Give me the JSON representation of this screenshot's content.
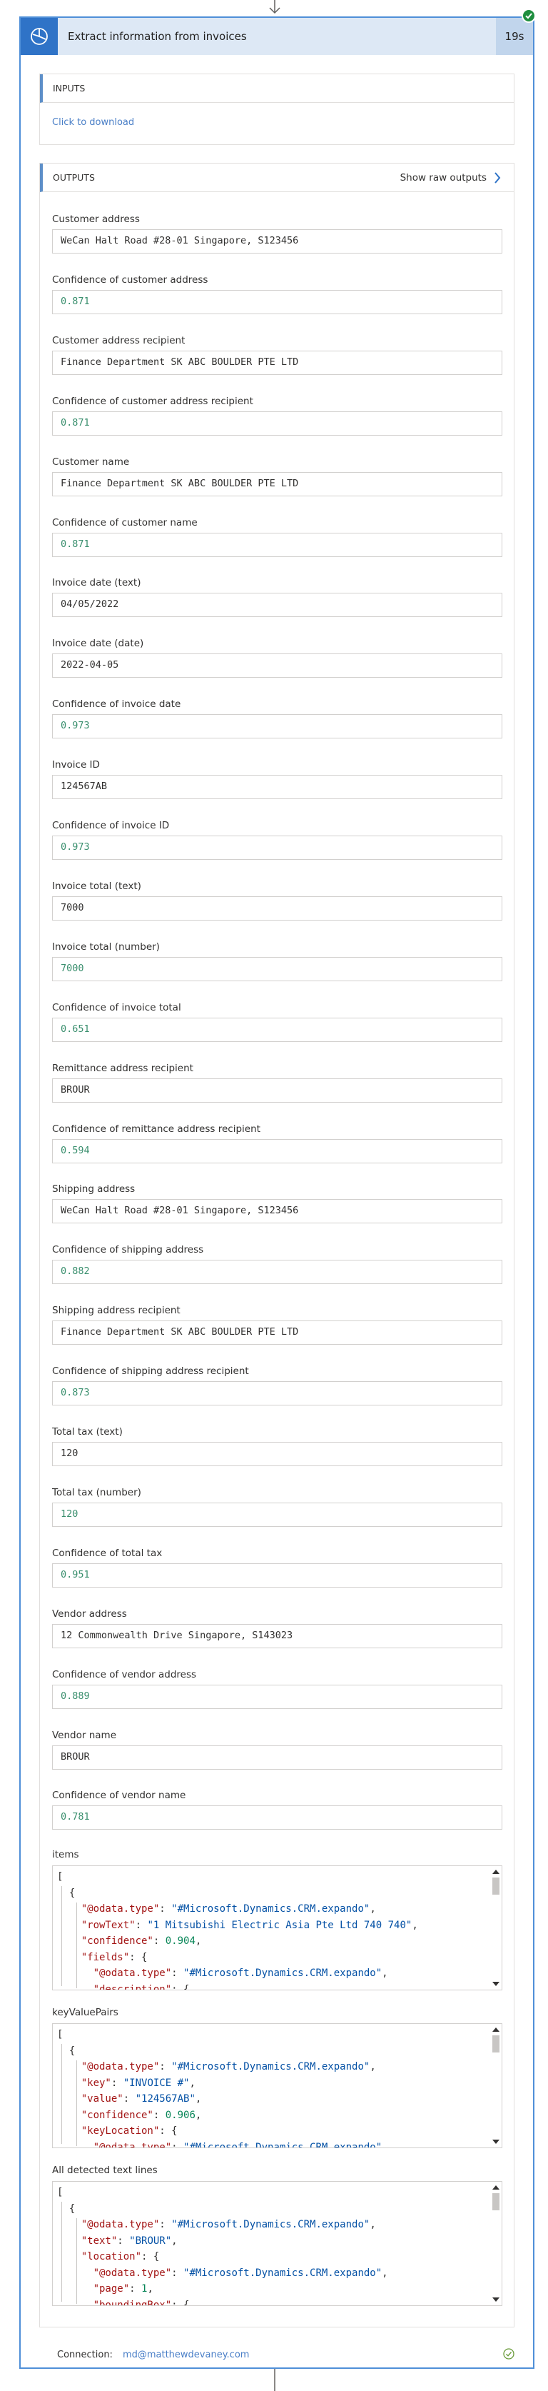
{
  "action": {
    "title": "Extract information from invoices",
    "duration": "19s",
    "status_icon": "success-check-icon",
    "app_icon": "ai-builder-icon"
  },
  "inputs": {
    "header": "INPUTS",
    "download_link": "Click to download"
  },
  "outputs": {
    "header": "OUTPUTS",
    "raw_button": "Show raw outputs",
    "fields": [
      {
        "label": "Customer address",
        "value": "WeCan Halt Road #28-01 Singapore, S123456",
        "kind": "str"
      },
      {
        "label": "Confidence of customer address",
        "value": "0.871",
        "kind": "num"
      },
      {
        "label": "Customer address recipient",
        "value": "Finance Department SK ABC BOULDER PTE LTD",
        "kind": "str"
      },
      {
        "label": "Confidence of customer address recipient",
        "value": "0.871",
        "kind": "num"
      },
      {
        "label": "Customer name",
        "value": "Finance Department SK ABC BOULDER PTE LTD",
        "kind": "str"
      },
      {
        "label": "Confidence of customer name",
        "value": "0.871",
        "kind": "num"
      },
      {
        "label": "Invoice date (text)",
        "value": "04/05/2022",
        "kind": "str"
      },
      {
        "label": "Invoice date (date)",
        "value": "2022-04-05",
        "kind": "str"
      },
      {
        "label": "Confidence of invoice date",
        "value": "0.973",
        "kind": "num"
      },
      {
        "label": "Invoice ID",
        "value": "124567AB",
        "kind": "str"
      },
      {
        "label": "Confidence of invoice ID",
        "value": "0.973",
        "kind": "num"
      },
      {
        "label": "Invoice total (text)",
        "value": "7000",
        "kind": "str"
      },
      {
        "label": "Invoice total (number)",
        "value": "7000",
        "kind": "num"
      },
      {
        "label": "Confidence of invoice total",
        "value": "0.651",
        "kind": "num"
      },
      {
        "label": "Remittance address recipient",
        "value": "BROUR",
        "kind": "str"
      },
      {
        "label": "Confidence of remittance address recipient",
        "value": "0.594",
        "kind": "num"
      },
      {
        "label": "Shipping address",
        "value": "WeCan Halt Road #28-01 Singapore, S123456",
        "kind": "str"
      },
      {
        "label": "Confidence of shipping address",
        "value": "0.882",
        "kind": "num"
      },
      {
        "label": "Shipping address recipient",
        "value": "Finance Department SK ABC BOULDER PTE LTD",
        "kind": "str"
      },
      {
        "label": "Confidence of shipping address recipient",
        "value": "0.873",
        "kind": "num"
      },
      {
        "label": "Total tax (text)",
        "value": "120",
        "kind": "str"
      },
      {
        "label": "Total tax (number)",
        "value": "120",
        "kind": "num"
      },
      {
        "label": "Confidence of total tax",
        "value": "0.951",
        "kind": "num"
      },
      {
        "label": "Vendor address",
        "value": "12 Commonwealth Drive Singapore, S143023",
        "kind": "str"
      },
      {
        "label": "Confidence of vendor address",
        "value": "0.889",
        "kind": "num"
      },
      {
        "label": "Vendor name",
        "value": "BROUR",
        "kind": "str"
      },
      {
        "label": "Confidence of vendor name",
        "value": "0.781",
        "kind": "num"
      }
    ],
    "json_fields": [
      {
        "label": "items",
        "lines": [
          [
            {
              "t": "p",
              "v": "["
            }
          ],
          [
            {
              "t": "p",
              "v": "  {"
            }
          ],
          [
            {
              "t": "p",
              "v": "    "
            },
            {
              "t": "k",
              "v": "\"@odata.type\""
            },
            {
              "t": "p",
              "v": ": "
            },
            {
              "t": "s",
              "v": "\"#Microsoft.Dynamics.CRM.expando\""
            },
            {
              "t": "p",
              "v": ","
            }
          ],
          [
            {
              "t": "p",
              "v": "    "
            },
            {
              "t": "k",
              "v": "\"rowText\""
            },
            {
              "t": "p",
              "v": ": "
            },
            {
              "t": "s",
              "v": "\"1 Mitsubishi Electric Asia Pte Ltd 740 740\""
            },
            {
              "t": "p",
              "v": ","
            }
          ],
          [
            {
              "t": "p",
              "v": "    "
            },
            {
              "t": "k",
              "v": "\"confidence\""
            },
            {
              "t": "p",
              "v": ": "
            },
            {
              "t": "n",
              "v": "0.904"
            },
            {
              "t": "p",
              "v": ","
            }
          ],
          [
            {
              "t": "p",
              "v": "    "
            },
            {
              "t": "k",
              "v": "\"fields\""
            },
            {
              "t": "p",
              "v": ": {"
            }
          ],
          [
            {
              "t": "p",
              "v": "      "
            },
            {
              "t": "k",
              "v": "\"@odata.type\""
            },
            {
              "t": "p",
              "v": ": "
            },
            {
              "t": "s",
              "v": "\"#Microsoft.Dynamics.CRM.expando\""
            },
            {
              "t": "p",
              "v": ","
            }
          ],
          [
            {
              "t": "p",
              "v": "      "
            },
            {
              "t": "k",
              "v": "\"description\""
            },
            {
              "t": "p",
              "v": ": {"
            }
          ]
        ]
      },
      {
        "label": "keyValuePairs",
        "lines": [
          [
            {
              "t": "p",
              "v": "["
            }
          ],
          [
            {
              "t": "p",
              "v": "  {"
            }
          ],
          [
            {
              "t": "p",
              "v": "    "
            },
            {
              "t": "k",
              "v": "\"@odata.type\""
            },
            {
              "t": "p",
              "v": ": "
            },
            {
              "t": "s",
              "v": "\"#Microsoft.Dynamics.CRM.expando\""
            },
            {
              "t": "p",
              "v": ","
            }
          ],
          [
            {
              "t": "p",
              "v": "    "
            },
            {
              "t": "k",
              "v": "\"key\""
            },
            {
              "t": "p",
              "v": ": "
            },
            {
              "t": "s",
              "v": "\"INVOICE #\""
            },
            {
              "t": "p",
              "v": ","
            }
          ],
          [
            {
              "t": "p",
              "v": "    "
            },
            {
              "t": "k",
              "v": "\"value\""
            },
            {
              "t": "p",
              "v": ": "
            },
            {
              "t": "s",
              "v": "\"124567AB\""
            },
            {
              "t": "p",
              "v": ","
            }
          ],
          [
            {
              "t": "p",
              "v": "    "
            },
            {
              "t": "k",
              "v": "\"confidence\""
            },
            {
              "t": "p",
              "v": ": "
            },
            {
              "t": "n",
              "v": "0.906"
            },
            {
              "t": "p",
              "v": ","
            }
          ],
          [
            {
              "t": "p",
              "v": "    "
            },
            {
              "t": "k",
              "v": "\"keyLocation\""
            },
            {
              "t": "p",
              "v": ": {"
            }
          ],
          [
            {
              "t": "p",
              "v": "      "
            },
            {
              "t": "k",
              "v": "\"@odata.type\""
            },
            {
              "t": "p",
              "v": ": "
            },
            {
              "t": "s",
              "v": "\"#Microsoft.Dynamics.CRM.expando\""
            }
          ]
        ]
      },
      {
        "label": "All detected text lines",
        "lines": [
          [
            {
              "t": "p",
              "v": "["
            }
          ],
          [
            {
              "t": "p",
              "v": "  {"
            }
          ],
          [
            {
              "t": "p",
              "v": "    "
            },
            {
              "t": "k",
              "v": "\"@odata.type\""
            },
            {
              "t": "p",
              "v": ": "
            },
            {
              "t": "s",
              "v": "\"#Microsoft.Dynamics.CRM.expando\""
            },
            {
              "t": "p",
              "v": ","
            }
          ],
          [
            {
              "t": "p",
              "v": "    "
            },
            {
              "t": "k",
              "v": "\"text\""
            },
            {
              "t": "p",
              "v": ": "
            },
            {
              "t": "s",
              "v": "\"BROUR\""
            },
            {
              "t": "p",
              "v": ","
            }
          ],
          [
            {
              "t": "p",
              "v": "    "
            },
            {
              "t": "k",
              "v": "\"location\""
            },
            {
              "t": "p",
              "v": ": {"
            }
          ],
          [
            {
              "t": "p",
              "v": "      "
            },
            {
              "t": "k",
              "v": "\"@odata.type\""
            },
            {
              "t": "p",
              "v": ": "
            },
            {
              "t": "s",
              "v": "\"#Microsoft.Dynamics.CRM.expando\""
            },
            {
              "t": "p",
              "v": ","
            }
          ],
          [
            {
              "t": "p",
              "v": "      "
            },
            {
              "t": "k",
              "v": "\"page\""
            },
            {
              "t": "p",
              "v": ": "
            },
            {
              "t": "n",
              "v": "1"
            },
            {
              "t": "p",
              "v": ","
            }
          ],
          [
            {
              "t": "p",
              "v": "      "
            },
            {
              "t": "k",
              "v": "\"boundingBox\""
            },
            {
              "t": "p",
              "v": ": {"
            }
          ]
        ]
      }
    ]
  },
  "footer": {
    "connection_label": "Connection:",
    "connection_email": "md@matthewdevaney.com",
    "connection_status_icon": "connection-ok-icon"
  },
  "colors": {
    "accent": "#2f73c7",
    "success": "#1e8e3e",
    "number_value": "#3a8f6e",
    "link": "#4a7fc7"
  }
}
